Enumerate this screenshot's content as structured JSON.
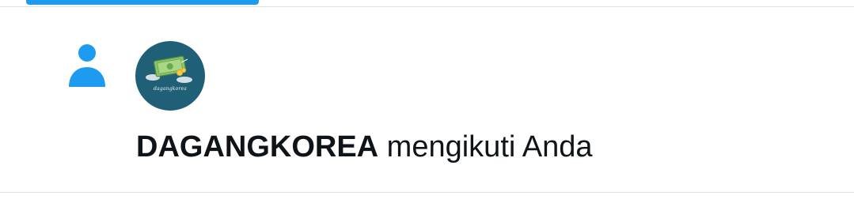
{
  "notification": {
    "user_name": "DAGANGKOREA",
    "action_text": " mengikuti Anda",
    "avatar_text": "dagangkorea"
  },
  "colors": {
    "accent": "#1d9bf0",
    "text": "#0f1419",
    "divider": "#dfe3e6",
    "avatar_background": "#1f6077"
  },
  "icons": {
    "notification_type": "person-icon",
    "avatar": "money-bill-icon"
  }
}
